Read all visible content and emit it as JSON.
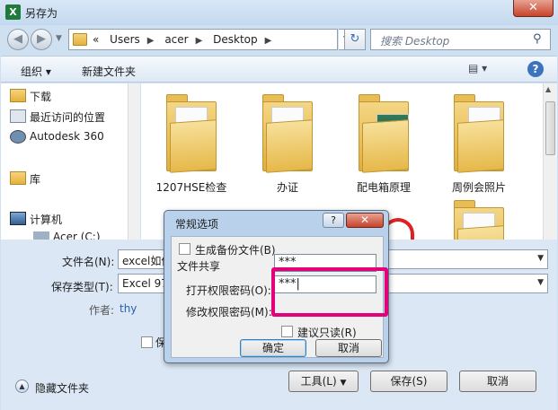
{
  "window": {
    "title": "另存为",
    "close_label": "✕",
    "app_icon": "excel-icon"
  },
  "address": {
    "segments": [
      "«",
      "Users",
      "acer",
      "Desktop"
    ],
    "search_placeholder": "搜索 Desktop"
  },
  "toolbar": {
    "organize": "组织 ▾",
    "new_folder": "新建文件夹"
  },
  "nav": {
    "items": [
      {
        "label": "下载",
        "icon": "download-folder-icon"
      },
      {
        "label": "最近访问的位置",
        "icon": "recent-places-icon"
      },
      {
        "label": "Autodesk 360",
        "icon": "autodesk-cloud-icon"
      },
      {
        "label": "库",
        "icon": "library-icon"
      },
      {
        "label": "计算机",
        "icon": "computer-icon"
      },
      {
        "label": "Acer (C:)",
        "icon": "drive-icon"
      }
    ]
  },
  "files": [
    {
      "label": "1207HSE检查"
    },
    {
      "label": "办证"
    },
    {
      "label": "配电箱原理"
    },
    {
      "label": "周例会照片"
    }
  ],
  "form": {
    "filename_label": "文件名(N):",
    "filename_value": "excel如何",
    "filetype_label": "保存类型(T):",
    "filetype_value": "Excel 97",
    "author_label": "作者:",
    "author_value": "thy",
    "thumbnail_label": "保"
  },
  "footer": {
    "hide_folders": "隐藏文件夹",
    "tools": "工具(L)",
    "save": "保存(S)",
    "cancel": "取消"
  },
  "modal": {
    "title": "常规选项",
    "help": "?",
    "close": "✕",
    "backup_label": "生成备份文件(B)",
    "share_group": "文件共享",
    "open_pw_label": "打开权限密码(O):",
    "open_pw_value": "***",
    "modify_pw_label": "修改权限密码(M):",
    "modify_pw_value": "***|",
    "readonly_label": "建议只读(R)",
    "ok": "确定",
    "cancel": "取消"
  },
  "colors": {
    "highlight": "#e4007a",
    "window_bg": "#cfe0f1"
  }
}
